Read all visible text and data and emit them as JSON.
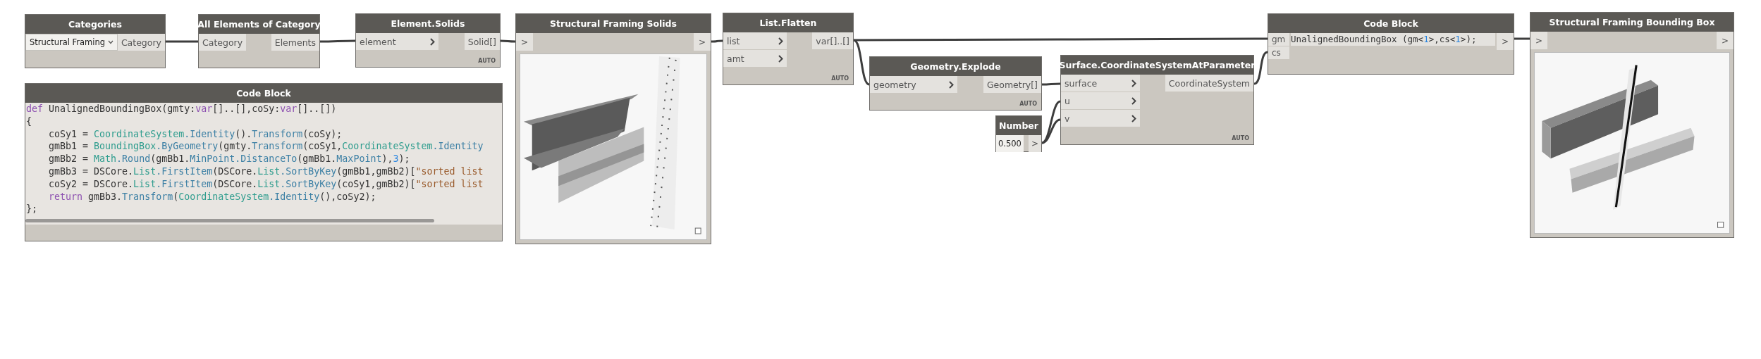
{
  "nodes": [
    {
      "kind": "dropdown",
      "title": "Categories",
      "value": "Structural Framing",
      "outputs": [
        "Category"
      ]
    },
    {
      "kind": "function",
      "title": "All Elements of Category",
      "inputs": [
        {
          "label": "Category",
          "chevron": false
        }
      ],
      "outputs": [
        "Elements"
      ]
    },
    {
      "kind": "function",
      "title": "Element.Solids",
      "inputs": [
        {
          "label": "element",
          "chevron": true
        }
      ],
      "outputs": [
        "Solid[]"
      ],
      "lacing": "AUTO"
    },
    {
      "kind": "code",
      "title": "Code Block",
      "scrollbar": true,
      "lines": [
        [
          {
            "text": "def",
            "kind": "keyword"
          },
          {
            "text": " UnalignedBoundingBox(gmty:",
            "kind": "plain"
          },
          {
            "text": "var",
            "kind": "keyword"
          },
          {
            "text": "[]..[],coSy:",
            "kind": "plain"
          },
          {
            "text": "var",
            "kind": "keyword"
          },
          {
            "text": "[]..[])",
            "kind": "plain"
          }
        ],
        [
          {
            "text": "{",
            "kind": "plain"
          }
        ],
        [
          {
            "text": "    coSy1 = ",
            "kind": "plain"
          },
          {
            "text": "CoordinateSystem",
            "kind": "type"
          },
          {
            "text": ".Identity",
            "kind": "member"
          },
          {
            "text": "().",
            "kind": "plain"
          },
          {
            "text": "Transform",
            "kind": "member"
          },
          {
            "text": "(coSy);",
            "kind": "plain"
          }
        ],
        [
          {
            "text": "    gmBb1 = ",
            "kind": "plain"
          },
          {
            "text": "BoundingBox",
            "kind": "type"
          },
          {
            "text": ".ByGeometry",
            "kind": "member"
          },
          {
            "text": "(gmty.",
            "kind": "plain"
          },
          {
            "text": "Transform",
            "kind": "member"
          },
          {
            "text": "(coSy1,",
            "kind": "plain"
          },
          {
            "text": "CoordinateSystem",
            "kind": "type"
          },
          {
            "text": ".Identity",
            "kind": "member"
          }
        ],
        [
          {
            "text": "    gmBb2 = ",
            "kind": "plain"
          },
          {
            "text": "Math",
            "kind": "type"
          },
          {
            "text": ".Round",
            "kind": "member"
          },
          {
            "text": "(gmBb1.",
            "kind": "plain"
          },
          {
            "text": "MinPoint",
            "kind": "member"
          },
          {
            "text": ".DistanceTo",
            "kind": "member"
          },
          {
            "text": "(gmBb1.",
            "kind": "plain"
          },
          {
            "text": "MaxPoint",
            "kind": "member"
          },
          {
            "text": "),",
            "kind": "plain"
          },
          {
            "text": "3",
            "kind": "number"
          },
          {
            "text": ");",
            "kind": "plain"
          }
        ],
        [
          {
            "text": "    gmBb3 = DSCore.",
            "kind": "plain"
          },
          {
            "text": "List",
            "kind": "type"
          },
          {
            "text": ".FirstItem",
            "kind": "member"
          },
          {
            "text": "(DSCore.",
            "kind": "plain"
          },
          {
            "text": "List",
            "kind": "type"
          },
          {
            "text": ".SortByKey",
            "kind": "member"
          },
          {
            "text": "(gmBb1,gmBb2)[",
            "kind": "plain"
          },
          {
            "text": "\"sorted list",
            "kind": "string"
          }
        ],
        [
          {
            "text": "    coSy2 = DSCore.",
            "kind": "plain"
          },
          {
            "text": "List",
            "kind": "type"
          },
          {
            "text": ".FirstItem",
            "kind": "member"
          },
          {
            "text": "(DSCore.",
            "kind": "plain"
          },
          {
            "text": "List",
            "kind": "type"
          },
          {
            "text": ".SortByKey",
            "kind": "member"
          },
          {
            "text": "(coSy1,gmBb2)[",
            "kind": "plain"
          },
          {
            "text": "\"sorted list",
            "kind": "string"
          }
        ],
        [
          {
            "text": "    return",
            "kind": "keyword"
          },
          {
            "text": " gmBb3.",
            "kind": "plain"
          },
          {
            "text": "Transform",
            "kind": "member"
          },
          {
            "text": "(",
            "kind": "plain"
          },
          {
            "text": "CoordinateSystem",
            "kind": "type"
          },
          {
            "text": ".Identity",
            "kind": "member"
          },
          {
            "text": "(),coSy2);",
            "kind": "plain"
          }
        ],
        [
          {
            "text": "};",
            "kind": "plain"
          }
        ]
      ]
    },
    {
      "kind": "watch3d",
      "title": "Structural Framing Solids",
      "input": ">",
      "output": ">"
    },
    {
      "kind": "function",
      "title": "List.Flatten",
      "inputs": [
        {
          "label": "list",
          "chevron": true
        },
        {
          "label": "amt",
          "chevron": true
        }
      ],
      "outputs": [
        "var[]..[]"
      ],
      "lacing": "AUTO"
    },
    {
      "kind": "function",
      "title": "Geometry.Explode",
      "inputs": [
        {
          "label": "geometry",
          "chevron": true
        }
      ],
      "outputs": [
        "Geometry[]"
      ],
      "lacing": "AUTO"
    },
    {
      "kind": "number",
      "title": "Number",
      "value": "0.500",
      "output": ">"
    },
    {
      "kind": "function",
      "title": "Surface.CoordinateSystemAtParameter",
      "inputs": [
        {
          "label": "surface",
          "chevron": true
        },
        {
          "label": "u",
          "chevron": true
        },
        {
          "label": "v",
          "chevron": true
        }
      ],
      "outputs": [
        "CoordinateSystem"
      ],
      "lacing": "AUTO"
    },
    {
      "kind": "code",
      "title": "Code Block",
      "inputs": [
        "gm",
        "cs"
      ],
      "output": ">",
      "lines": [
        [
          {
            "text": "UnalignedBoundingBox (gm<",
            "kind": "plain"
          },
          {
            "text": "1",
            "kind": "number"
          },
          {
            "text": ">,cs<",
            "kind": "plain"
          },
          {
            "text": "1",
            "kind": "number"
          },
          {
            "text": ">);",
            "kind": "plain"
          }
        ]
      ]
    },
    {
      "kind": "watch3d",
      "title": "Structural Framing Bounding Box",
      "input": ">",
      "output": ">"
    }
  ]
}
